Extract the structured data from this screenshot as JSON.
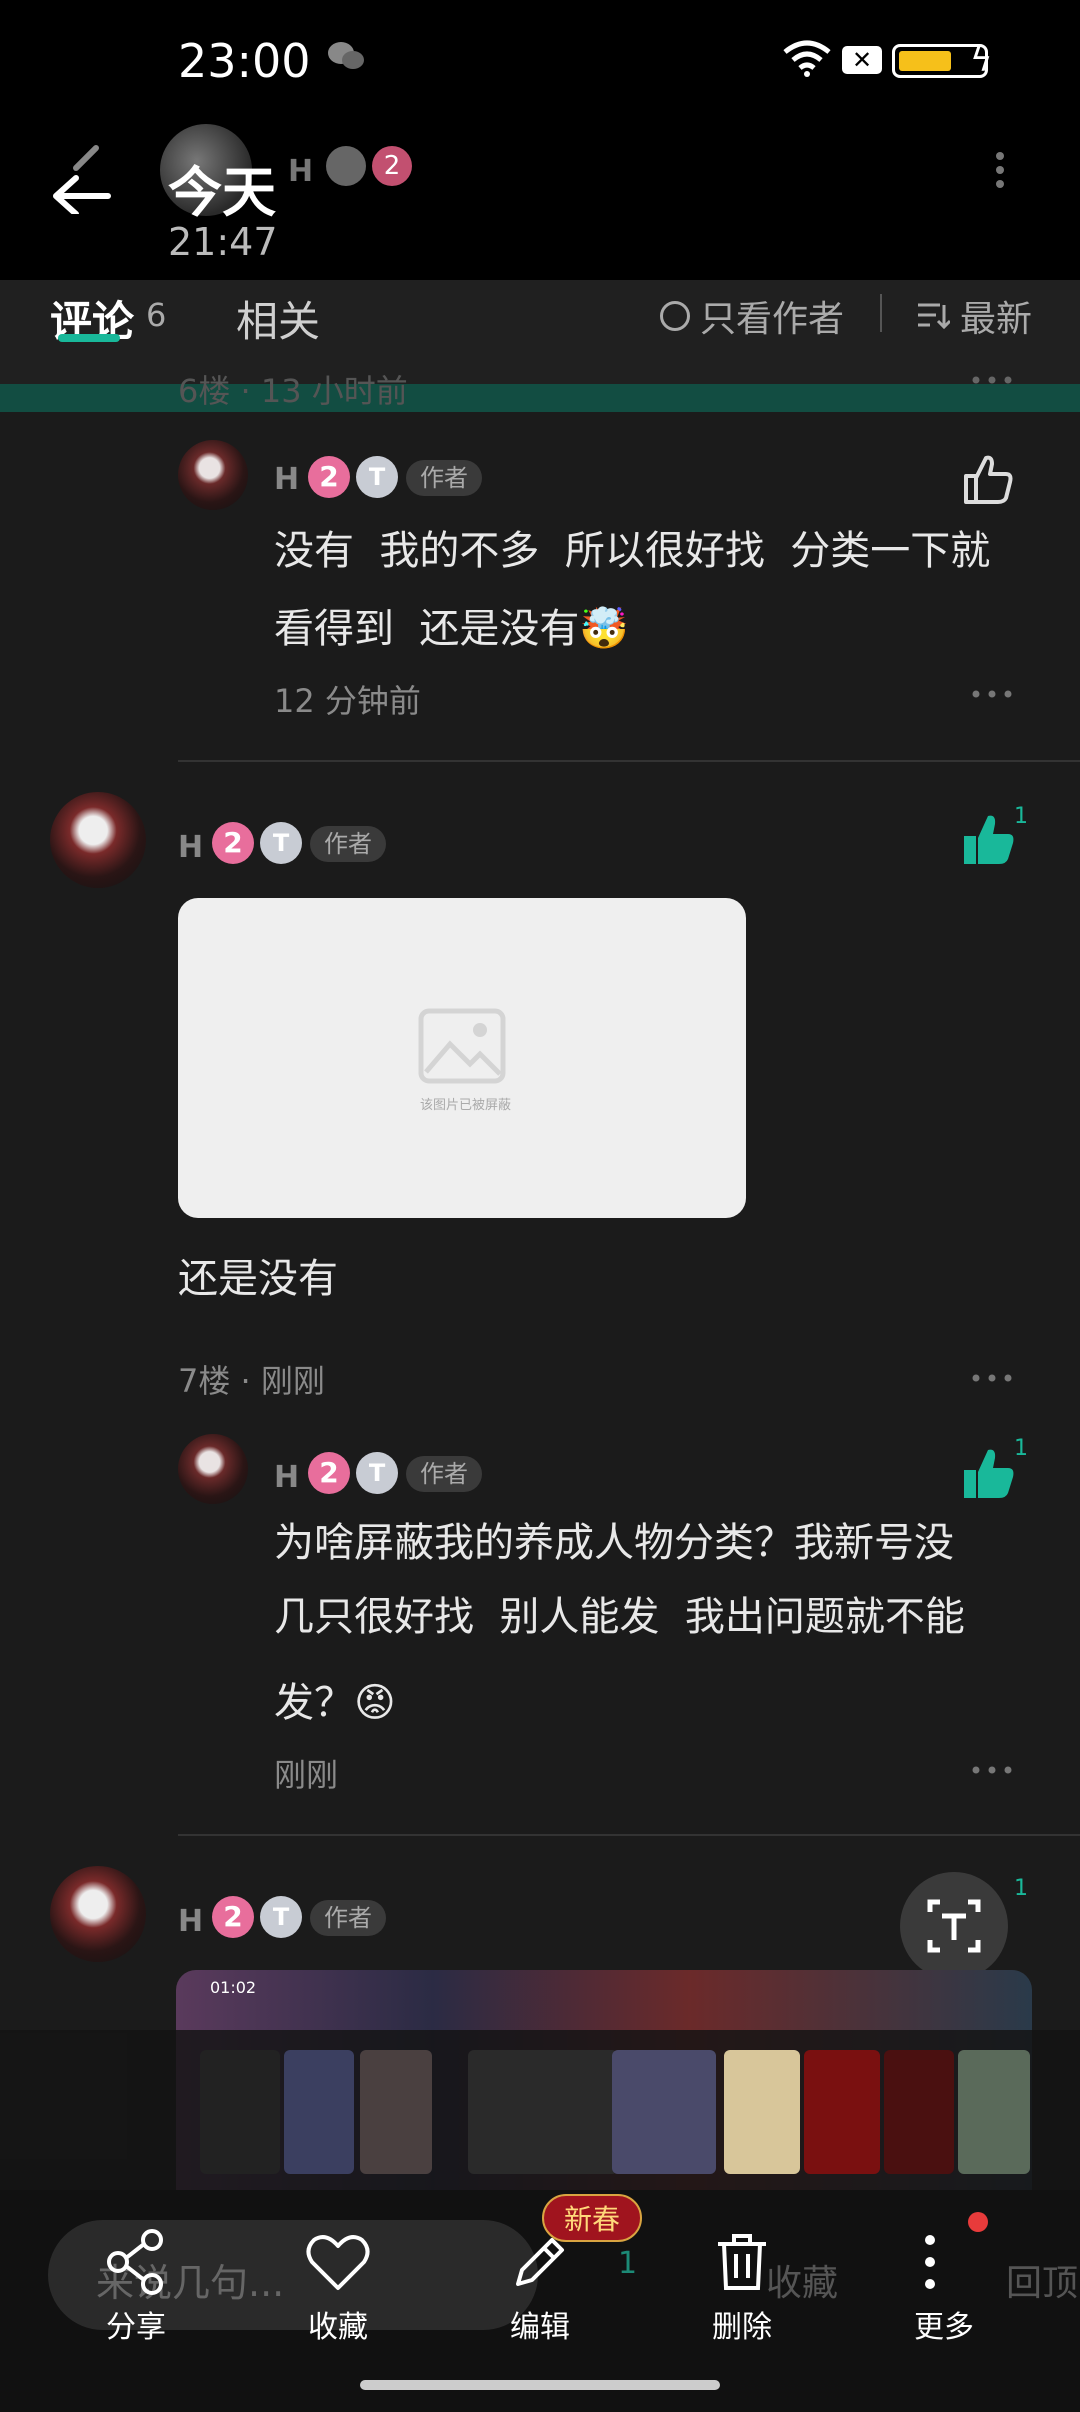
{
  "status_bar": {
    "time": "23:00",
    "sim": "✕"
  },
  "header": {
    "title": "今天",
    "time": "21:47",
    "name": "H",
    "badge2": "2"
  },
  "tabs": {
    "comments": "评论",
    "comments_count": "6",
    "related": "相关",
    "only_author": "只看作者",
    "latest": "最新"
  },
  "floor_top": "6楼 · 13 小时前",
  "comments": [
    {
      "name": "H",
      "badge_pink": "2",
      "badge_grey": "T",
      "tag": "作者",
      "text1": "没有  我的不多  所以很好找  分类一下就",
      "text2": "看得到  还是没有🤯",
      "time": "12 分钟前"
    },
    {
      "name": "H",
      "badge_pink": "2",
      "badge_grey": "T",
      "tag": "作者",
      "like_count": "1",
      "image_note": "该图片已被屏蔽",
      "text": "还是没有",
      "floor": "7楼 · 刚刚"
    },
    {
      "name": "H",
      "badge_pink": "2",
      "badge_grey": "T",
      "tag": "作者",
      "like_count": "1",
      "text1": "为啥屏蔽我的养成人物分类？我新号没",
      "text2": "几只很好找  别人能发  我出问题就不能",
      "text3": "发？😡",
      "time": "刚刚"
    },
    {
      "name": "H",
      "badge_pink": "2",
      "badge_grey": "T",
      "tag": "作者",
      "like_count": "1"
    }
  ],
  "screenshot_preview": {
    "time": "01:02"
  },
  "bottom_bar": {
    "input_placeholder": "来说几句...",
    "share": "分享",
    "favorite": "收藏",
    "edit": "编辑",
    "new_badge": "新春",
    "delete": "删除",
    "more": "更多",
    "ghost_like_count": "1",
    "ghost_favorite": "收藏",
    "ghost_top": "回顶"
  },
  "colors": {
    "accent": "#19b89a",
    "background": "#1b1b1b"
  }
}
